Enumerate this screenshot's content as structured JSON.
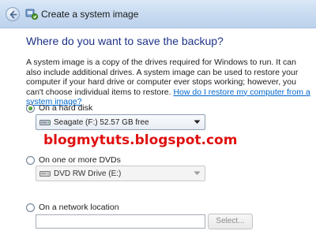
{
  "window": {
    "title": "Create a system image"
  },
  "main": {
    "heading": "Where do you want to save the backup?",
    "description": "A system image is a copy of the drives required for Windows to run. It can also include additional drives. A system image can be used to restore your computer if your hard drive or computer ever stops working; however, you can't choose individual items to restore. ",
    "help_link": "How do I restore my computer from a system image?"
  },
  "options": {
    "hard_disk": {
      "label": "On a hard disk",
      "selected": true,
      "dropdown_value": "Seagate (F:)  52.57 GB free"
    },
    "dvds": {
      "label": "On one or more DVDs",
      "selected": false,
      "dropdown_value": "DVD RW Drive (E:)"
    },
    "network": {
      "label": "On a network location",
      "selected": false,
      "input_value": "",
      "select_button": "Select..."
    }
  },
  "watermark": "blogmytuts.blogspot.com",
  "colors": {
    "heading": "#1e3287",
    "link": "#0066cc",
    "watermark": "#e01010",
    "titlebar": "#c6d9f0"
  }
}
